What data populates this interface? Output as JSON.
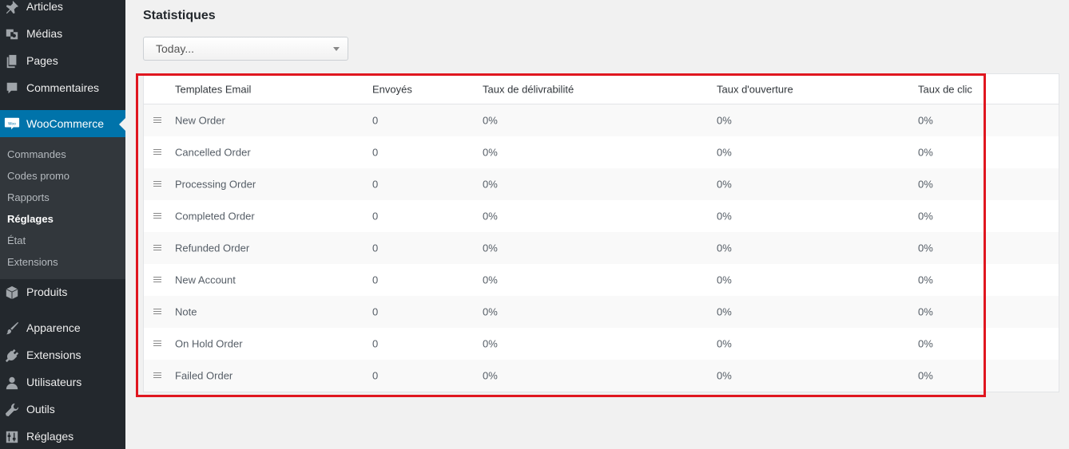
{
  "sidebar": {
    "items": [
      {
        "label": "Articles",
        "icon": "pin-icon"
      },
      {
        "label": "Médias",
        "icon": "media-icon"
      },
      {
        "label": "Pages",
        "icon": "pages-icon"
      },
      {
        "label": "Commentaires",
        "icon": "comment-icon"
      },
      {
        "label": "WooCommerce",
        "icon": "woocommerce-icon"
      },
      {
        "label": "Produits",
        "icon": "box-icon"
      },
      {
        "label": "Apparence",
        "icon": "brush-icon"
      },
      {
        "label": "Extensions",
        "icon": "plugin-icon"
      },
      {
        "label": "Utilisateurs",
        "icon": "user-icon"
      },
      {
        "label": "Outils",
        "icon": "wrench-icon"
      },
      {
        "label": "Réglages",
        "icon": "settings-icon"
      }
    ],
    "woo_badge": "Woo",
    "submenu": [
      "Commandes",
      "Codes promo",
      "Rapports",
      "Réglages",
      "État",
      "Extensions"
    ],
    "submenu_current": "Réglages",
    "colors": {
      "bg": "#23282d",
      "active": "#0073aa",
      "submenu_bg": "#32373c"
    }
  },
  "main": {
    "title": "Statistiques",
    "period_select": {
      "value": "Today..."
    },
    "table": {
      "headers": [
        "Templates Email",
        "Envoyés",
        "Taux de délivrabilité",
        "Taux d'ouverture",
        "Taux de clic"
      ],
      "rows": [
        {
          "name": "New Order",
          "sent": "0",
          "delivery": "0%",
          "open": "0%",
          "click": "0%"
        },
        {
          "name": "Cancelled Order",
          "sent": "0",
          "delivery": "0%",
          "open": "0%",
          "click": "0%"
        },
        {
          "name": "Processing Order",
          "sent": "0",
          "delivery": "0%",
          "open": "0%",
          "click": "0%"
        },
        {
          "name": "Completed Order",
          "sent": "0",
          "delivery": "0%",
          "open": "0%",
          "click": "0%"
        },
        {
          "name": "Refunded Order",
          "sent": "0",
          "delivery": "0%",
          "open": "0%",
          "click": "0%"
        },
        {
          "name": "New Account",
          "sent": "0",
          "delivery": "0%",
          "open": "0%",
          "click": "0%"
        },
        {
          "name": "Note",
          "sent": "0",
          "delivery": "0%",
          "open": "0%",
          "click": "0%"
        },
        {
          "name": "On Hold Order",
          "sent": "0",
          "delivery": "0%",
          "open": "0%",
          "click": "0%"
        },
        {
          "name": "Failed Order",
          "sent": "0",
          "delivery": "0%",
          "open": "0%",
          "click": "0%"
        }
      ]
    },
    "highlight_color": "#e0161f"
  }
}
